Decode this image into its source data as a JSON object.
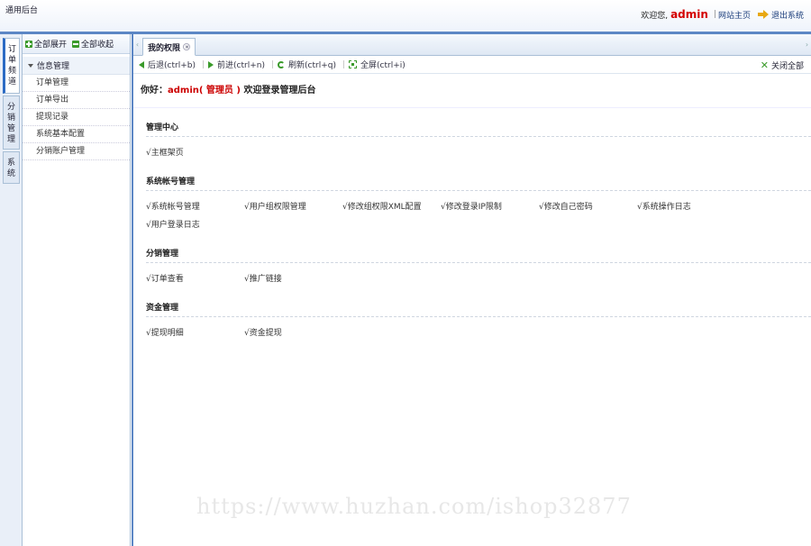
{
  "header": {
    "brand": "通用后台",
    "welcome": "欢迎您,",
    "username": "admin",
    "separator": "|",
    "home_link": "网站主页",
    "exit_link": "退出系统"
  },
  "vtabs": [
    {
      "label": [
        "订",
        "单",
        "频",
        "道"
      ],
      "active": true
    },
    {
      "label": [
        "分",
        "销",
        "管",
        "理"
      ],
      "active": false
    },
    {
      "label": [
        "系",
        "统"
      ],
      "active": false
    }
  ],
  "tree": {
    "expand_all": "全部展开",
    "collapse_all": "全部收起",
    "group": "信息管理",
    "items": [
      "订单管理",
      "订单导出",
      "提现记录",
      "系统基本配置",
      "分销账户管理"
    ]
  },
  "tabs": [
    {
      "label": "我的权限"
    }
  ],
  "toolbar": {
    "back": "后退(ctrl+b)",
    "forward": "前进(ctrl+n)",
    "refresh": "刷新(ctrl+q)",
    "fullscreen": "全屏(ctrl+i)",
    "close_all": "关闭全部",
    "sep": "|"
  },
  "greeting": {
    "prefix": "你好：",
    "user": "admin( 管理员 )",
    "suffix": " 欢迎登录管理后台"
  },
  "sections": [
    {
      "title": "管理中心",
      "perms": [
        "√主框架页"
      ]
    },
    {
      "title": "系统帐号管理",
      "perms": [
        "√系统帐号管理",
        "√用户组权限管理",
        "√修改组权限XML配置",
        "√修改登录IP限制",
        "√修改自己密码",
        "√系统操作日志",
        "√用户登录日志"
      ]
    },
    {
      "title": "分销管理",
      "perms": [
        "√订单查看",
        "√推广链接"
      ]
    },
    {
      "title": "资金管理",
      "perms": [
        "√提现明细",
        "√资金提现"
      ]
    }
  ],
  "watermark": "https://www.huzhan.com/ishop32877"
}
